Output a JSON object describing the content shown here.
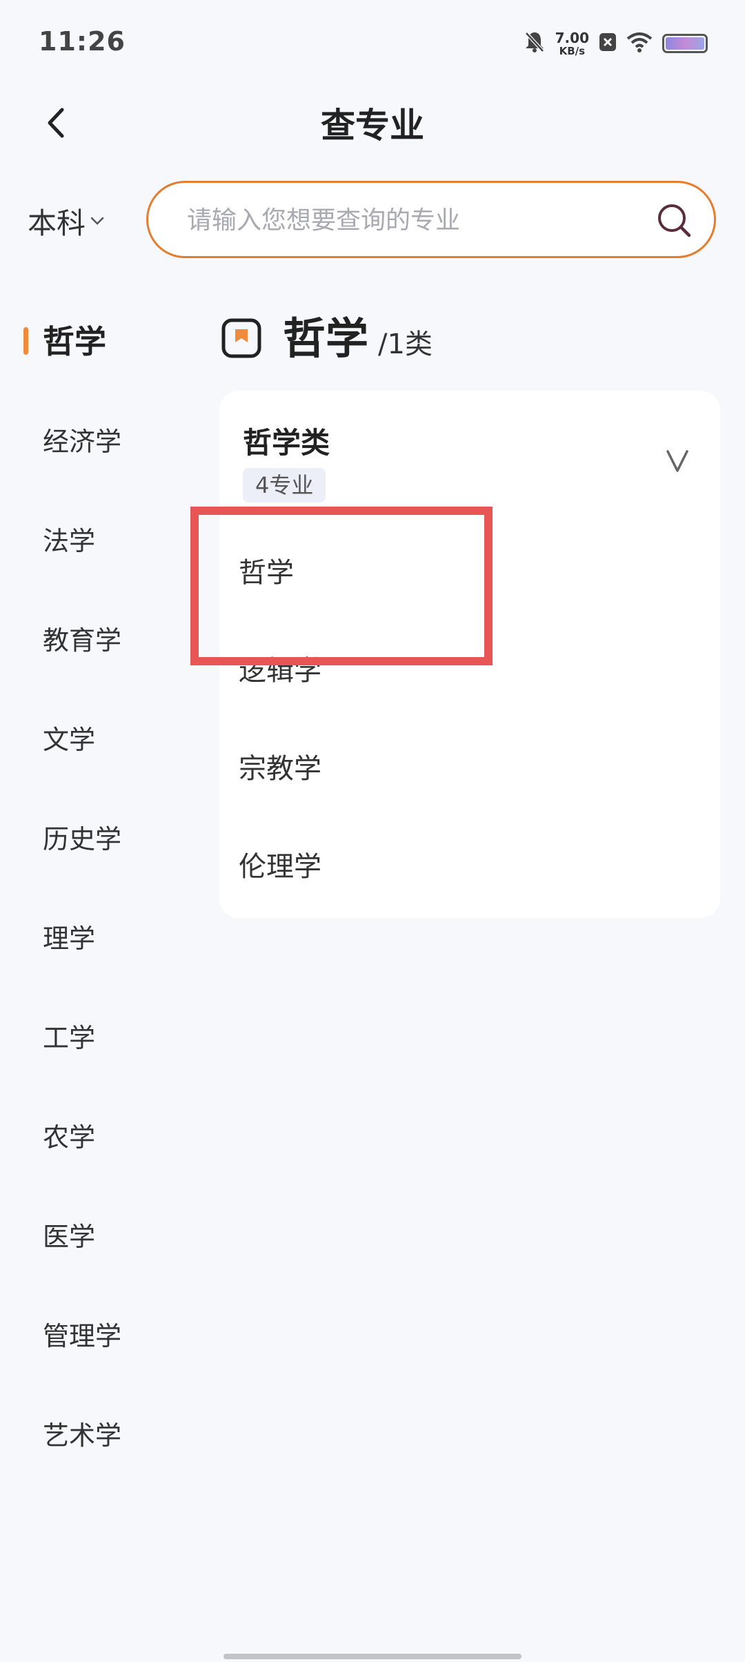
{
  "status_bar": {
    "time": "11:26",
    "net_speed_value": "7.00",
    "net_speed_unit": "KB/s",
    "icons": [
      "mute-bell-icon",
      "close-box-icon",
      "wifi-icon",
      "battery-icon"
    ]
  },
  "header": {
    "title": "查专业",
    "back_icon": "chevron-left-icon"
  },
  "filter": {
    "level_label": "本科"
  },
  "search": {
    "placeholder": "请输入您想要查询的专业",
    "accent_color": "#e47d2d"
  },
  "sidebar": {
    "items": [
      {
        "label": "哲学",
        "active": true
      },
      {
        "label": "经济学"
      },
      {
        "label": "法学"
      },
      {
        "label": "教育学"
      },
      {
        "label": "文学"
      },
      {
        "label": "历史学"
      },
      {
        "label": "理学"
      },
      {
        "label": "工学"
      },
      {
        "label": "农学"
      },
      {
        "label": "医学"
      },
      {
        "label": "管理学"
      },
      {
        "label": "艺术学"
      }
    ]
  },
  "main": {
    "category_title": "哲学",
    "category_count": "/1类",
    "group": {
      "title": "哲学类",
      "badge": "4专业",
      "majors": [
        "哲学",
        "逻辑学",
        "宗教学",
        "伦理学"
      ]
    }
  },
  "highlight_color": "#e85555"
}
